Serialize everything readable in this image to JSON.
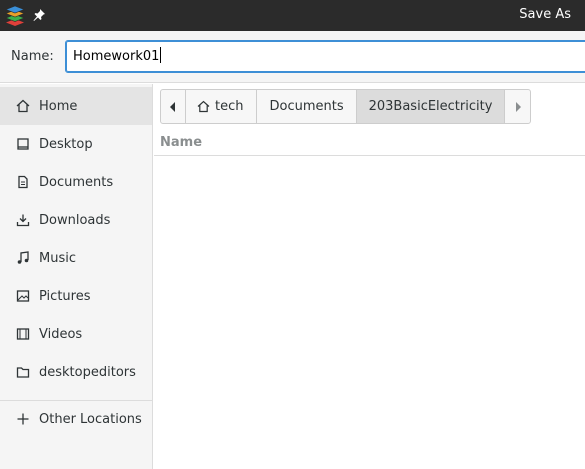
{
  "window": {
    "title": "Save As"
  },
  "name_field": {
    "label": "Name:",
    "value": "Homework01"
  },
  "sidebar": {
    "items": [
      {
        "label": "Home",
        "icon": "home-icon",
        "selected": true
      },
      {
        "label": "Desktop",
        "icon": "desktop-icon"
      },
      {
        "label": "Documents",
        "icon": "documents-icon"
      },
      {
        "label": "Downloads",
        "icon": "downloads-icon"
      },
      {
        "label": "Music",
        "icon": "music-icon"
      },
      {
        "label": "Pictures",
        "icon": "pictures-icon"
      },
      {
        "label": "Videos",
        "icon": "videos-icon"
      },
      {
        "label": "desktopeditors",
        "icon": "folder-icon"
      }
    ],
    "other_locations": {
      "label": "Other Locations",
      "icon": "plus-icon"
    }
  },
  "pathbar": {
    "crumbs": [
      "tech",
      "Documents",
      "203BasicElectricity"
    ]
  },
  "file_list": {
    "columns": [
      "Name"
    ]
  },
  "colors": {
    "accent": "#3d8fd6",
    "titlebar": "#2b2b2b",
    "sidebar_bg": "#f5f5f5"
  }
}
